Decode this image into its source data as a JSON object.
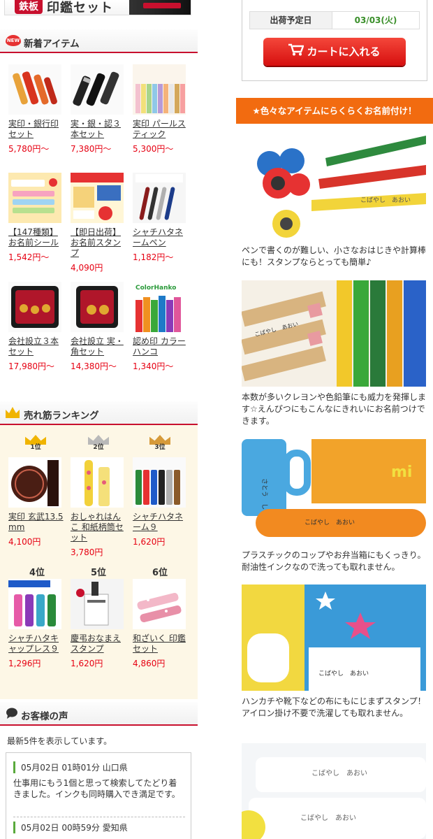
{
  "banner": {
    "text_left": "鉄板",
    "text_main": "印鑑セット"
  },
  "new_items": {
    "title": "新着アイテム",
    "icon_text": "NEW",
    "items": [
      {
        "name": "実印・銀行印セット",
        "price": "5,780円〜"
      },
      {
        "name": "実・銀・認３本セット",
        "price": "7,380円〜"
      },
      {
        "name": "実印 パールスティック",
        "price": "5,300円〜"
      },
      {
        "name": "【147種類】お名前シール",
        "price": "1,542円〜"
      },
      {
        "name": "【即日出荷】お名前スタンプ",
        "price": "4,090円"
      },
      {
        "name": "シャチハタネームペン",
        "price": "1,182円〜"
      },
      {
        "name": "会社設立３本セット",
        "price": "17,980円〜"
      },
      {
        "name": "会社設立 実・角セット",
        "price": "14,380円〜"
      },
      {
        "name": "認め印 カラーハンコ",
        "price": "1,340円〜"
      }
    ]
  },
  "ranking": {
    "title": "売れ筋ランキング",
    "items": [
      {
        "rank": "1位",
        "name": "実印 玄武13.5mm",
        "price": "4,100円"
      },
      {
        "rank": "2位",
        "name": "おしゃれはんこ 和紙柄筒セット",
        "price": "3,780円"
      },
      {
        "rank": "3位",
        "name": "シャチハタネーム９",
        "price": "1,620円"
      },
      {
        "rank": "4位",
        "name": "シャチハタキャップレス９",
        "price": "1,296円"
      },
      {
        "rank": "5位",
        "name": "慶弔おなまえスタンプ",
        "price": "1,620円"
      },
      {
        "rank": "6位",
        "name": "和ざいく 印鑑セット",
        "price": "4,860円"
      }
    ],
    "colors": {
      "gold": "#f0b400",
      "silver": "#b9b9b9",
      "bronze": "#d69a3a"
    }
  },
  "voices": {
    "title": "お客様の声",
    "intro": "最新5件を表示しています。",
    "reviews": [
      {
        "meta": "05月02日 01時01分  山口県",
        "body": "仕事用にもう1個と思って検索してたどり着きました。インクも同時購入でき満足です。"
      },
      {
        "meta": "05月02日 00時59分  愛知県",
        "body": ""
      }
    ]
  },
  "shipping": {
    "label": "出荷予定日",
    "date": "03/03(火)",
    "cart_label": "カートに入れる"
  },
  "feature": {
    "title": "★色々なアイテムにらくらくお名前付け！",
    "captions": [
      "ペンで書くのが難しい、小さなおはじきや計算棒にも！スタンプならとっても簡単♪",
      "本数が多いクレヨンや色鉛筆にも威力を発揮します☆えんぴつにもこんなにきれいにお名前つけできます。",
      "プラスチックのコップやお弁当箱にもくっきり。耐油性インクなので洗っても取れません。",
      "ハンカチや靴下などの布にもにじまずスタンプ！アイロン掛け不要で洗濯しても取れません。"
    ],
    "stamp_name": "こばやし　あおい",
    "stamp_name_2": "さとう　しょうた",
    "bento_text": "mi"
  },
  "colors": {
    "accent_red": "#c8102e",
    "price_red": "#e60012",
    "orange": "#f26b10",
    "green": "#3a8f2a"
  }
}
